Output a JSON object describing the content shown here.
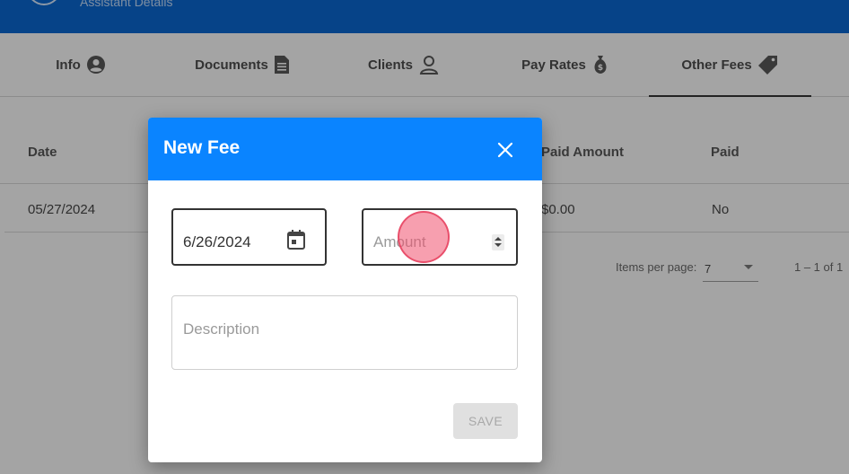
{
  "header": {
    "subtitle": "Assistant Details"
  },
  "tabs": [
    {
      "label": "Info",
      "icon": "user-circle-icon"
    },
    {
      "label": "Documents",
      "icon": "document-icon"
    },
    {
      "label": "Clients",
      "icon": "client-icon"
    },
    {
      "label": "Pay Rates",
      "icon": "money-bag-icon"
    },
    {
      "label": "Other Fees",
      "icon": "price-tag-icon",
      "active": true
    }
  ],
  "table": {
    "columns": [
      "Date",
      "Paid Amount",
      "Paid"
    ],
    "rows": [
      {
        "date": "05/27/2024",
        "paid_amount": "$0.00",
        "paid": "No"
      }
    ]
  },
  "pagination": {
    "items_per_page_label": "Items per page:",
    "items_per_page_value": "7",
    "range": "1 – 1 of 1"
  },
  "dialog": {
    "title": "New Fee",
    "date_value": "6/26/2024",
    "amount_placeholder": "Amount",
    "description_placeholder": "Description",
    "save_label": "SAVE"
  },
  "colors": {
    "topbar": "#0a63c9",
    "dialog_header": "#0a84ff",
    "click_indicator": "#f0506e"
  }
}
